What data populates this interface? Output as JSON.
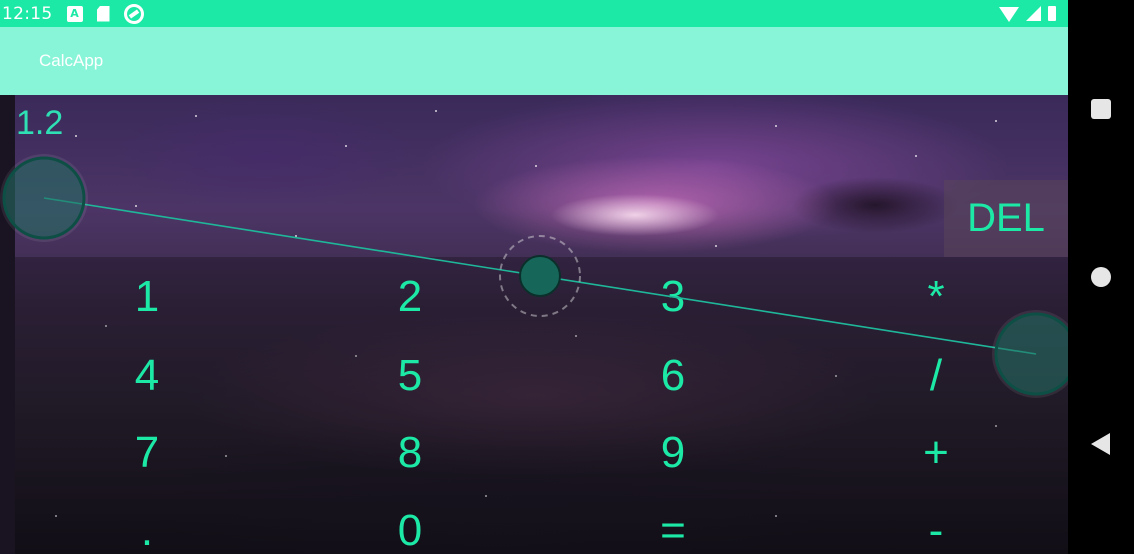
{
  "status_bar": {
    "time": "12:15",
    "icons": [
      "a-notification-icon",
      "sd-card-icon",
      "sync-icon",
      "wifi-icon",
      "signal-icon",
      "battery-icon"
    ]
  },
  "app_bar": {
    "title": "CalcApp"
  },
  "display": {
    "input_value": "1.2"
  },
  "delete_button": {
    "label": "DEL"
  },
  "keypad": {
    "rows": [
      [
        "1",
        "2",
        "3",
        "*"
      ],
      [
        "4",
        "5",
        "6",
        "/"
      ],
      [
        "7",
        "8",
        "9",
        "+"
      ],
      [
        ".",
        "0",
        "=",
        "-"
      ]
    ]
  },
  "nav_bar": {
    "icons": [
      "recents-icon",
      "home-icon",
      "back-icon"
    ]
  },
  "colors": {
    "accent": "#1de9a6",
    "app_bar": "#88f4d8",
    "gesture_line": "#1fb79a",
    "touch_marker": "#17665a"
  }
}
